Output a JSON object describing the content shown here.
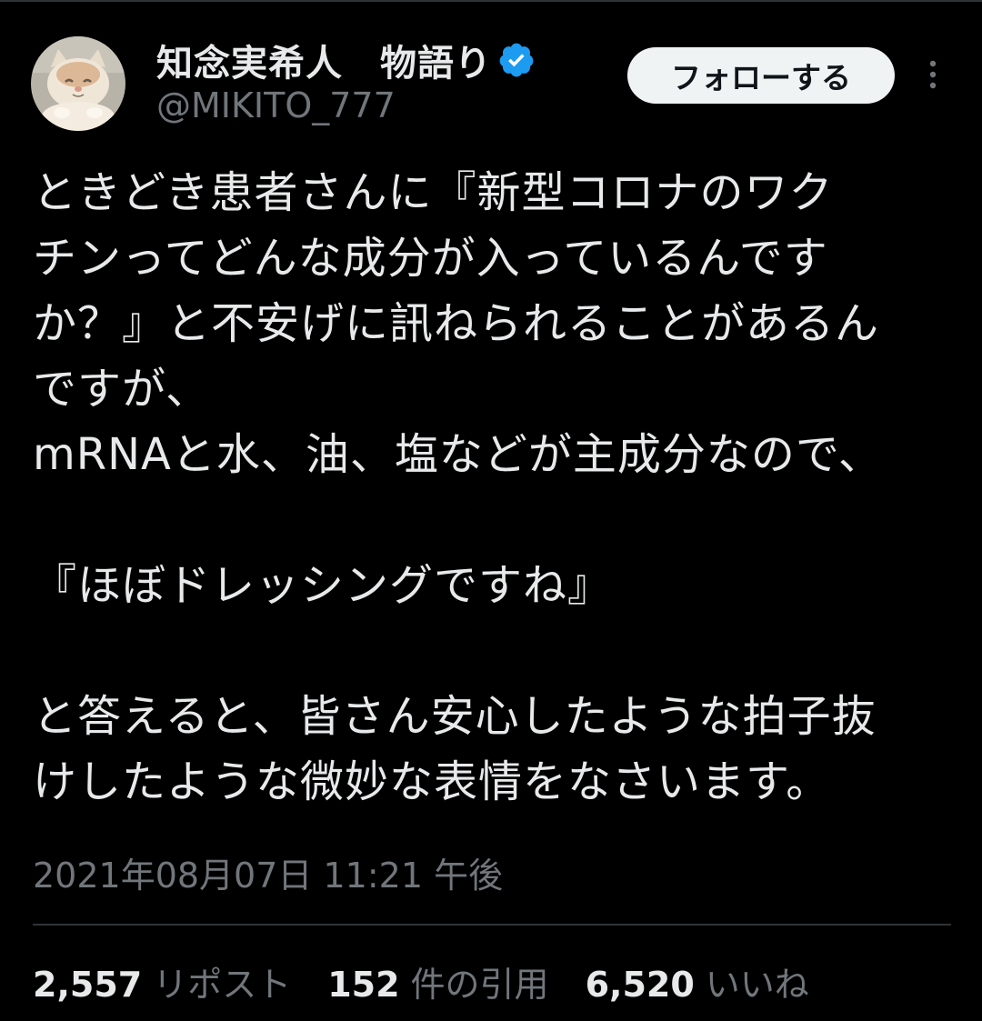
{
  "user": {
    "display_name": "知念実希人　物語り",
    "handle": "@MIKITO_777",
    "avatar_icon": "cat-avatar-icon",
    "verified_icon": "verified-badge-icon",
    "verified_color": "#1d9bf0"
  },
  "actions": {
    "follow_label": "フォローする",
    "more_icon": "more-vertical-icon"
  },
  "tweet": {
    "lines": [
      "ときどき患者さんに『新型コロナのワク",
      "チンってどんな成分が入っているんです",
      "か？』と不安げに訊ねられることがあるん",
      "ですが、",
      "mRNAと水、油、塩などが主成分なので、",
      "",
      "『ほぼドレッシングですね』",
      "",
      "と答えると、皆さん安心したような拍子抜",
      "けしたような微妙な表情をなさいます。"
    ],
    "timestamp": "2021年08月07日 11:21 午後"
  },
  "stats": {
    "reposts_count": "2,557",
    "reposts_label": "リポスト",
    "quotes_count": "152",
    "quotes_label": "件の引用",
    "likes_count": "6,520",
    "likes_label": "いいね"
  },
  "colors": {
    "background": "#000000",
    "text_primary": "#e7e9ea",
    "text_secondary": "#71767b",
    "divider": "#2f3336",
    "button_bg": "#eff3f4",
    "button_text": "#0f1419"
  }
}
